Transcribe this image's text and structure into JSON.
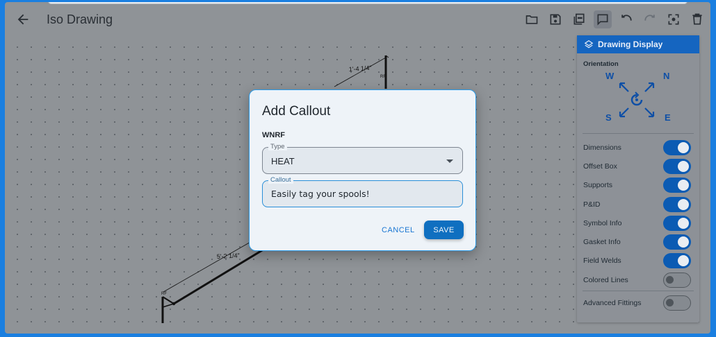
{
  "app": {
    "title": "Iso Drawing"
  },
  "toolbar": {
    "icons": [
      "folder-icon",
      "save-icon",
      "pdf-icon",
      "comment-icon",
      "undo-icon",
      "redo-icon",
      "fit-screen-icon",
      "delete-icon"
    ],
    "active": "comment-icon"
  },
  "drawing": {
    "dimensions": [
      "1'-4 1/4\"",
      "5'-2 1/4\""
    ],
    "markers": [
      "RF",
      "RF"
    ]
  },
  "panel": {
    "title": "Drawing Display",
    "orientation_label": "Orientation",
    "compass": {
      "w": "W",
      "n": "N",
      "s": "S",
      "e": "E"
    },
    "toggles": [
      {
        "label": "Dimensions",
        "on": true
      },
      {
        "label": "Offset Box",
        "on": true
      },
      {
        "label": "Supports",
        "on": true
      },
      {
        "label": "P&ID",
        "on": true
      },
      {
        "label": "Symbol Info",
        "on": true
      },
      {
        "label": "Gasket Info",
        "on": true
      },
      {
        "label": "Field Welds",
        "on": true
      },
      {
        "label": "Colored Lines",
        "on": false
      }
    ],
    "advanced": {
      "label": "Advanced Fittings",
      "on": false
    }
  },
  "dialog": {
    "title": "Add Callout",
    "subtitle": "WNRF",
    "type_label": "Type",
    "type_value": "HEAT",
    "callout_label": "Callout",
    "callout_value": "Easily tag your spools!",
    "cancel_label": "CANCEL",
    "save_label": "SAVE"
  },
  "colors": {
    "accent": "#1565c0",
    "save_button": "#0f6fc0",
    "dialog_border": "#2a9be8"
  }
}
